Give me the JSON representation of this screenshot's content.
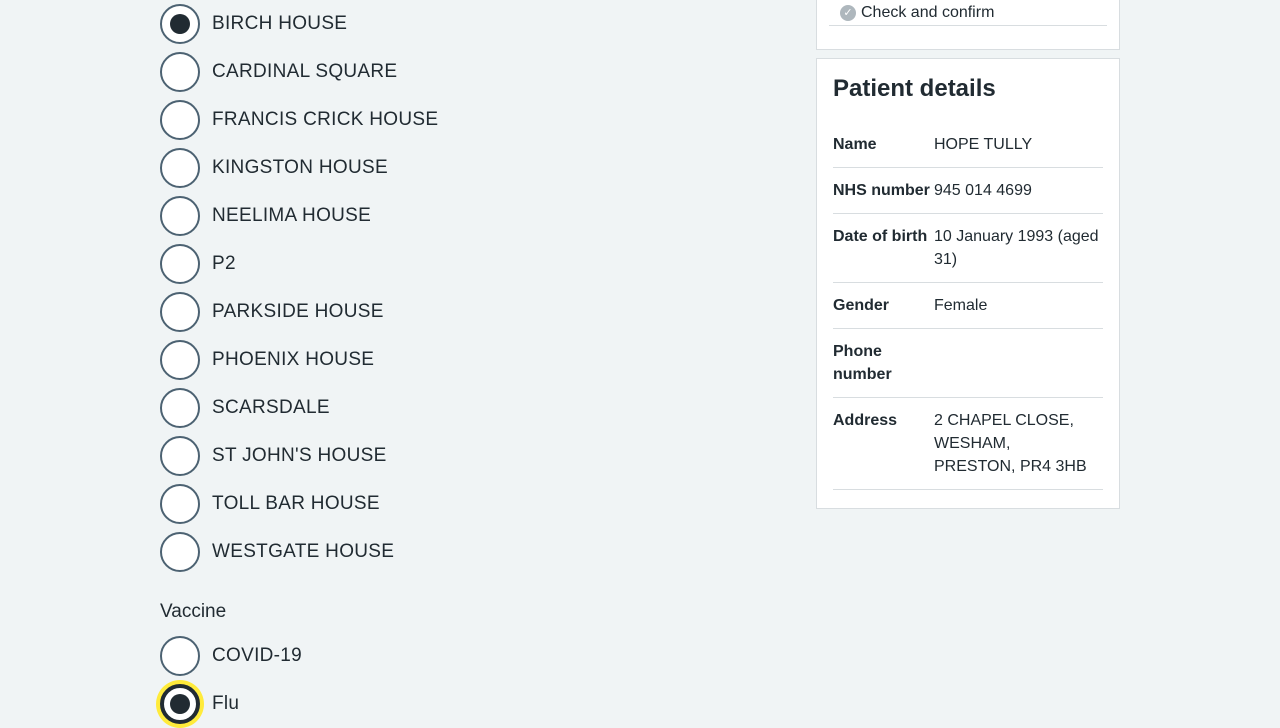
{
  "sites": {
    "options": [
      {
        "label": "BIRCH HOUSE",
        "checked": true
      },
      {
        "label": "CARDINAL SQUARE",
        "checked": false
      },
      {
        "label": "FRANCIS CRICK HOUSE",
        "checked": false
      },
      {
        "label": "KINGSTON HOUSE",
        "checked": false
      },
      {
        "label": "NEELIMA HOUSE",
        "checked": false
      },
      {
        "label": "P2",
        "checked": false
      },
      {
        "label": "PARKSIDE HOUSE",
        "checked": false
      },
      {
        "label": "PHOENIX HOUSE",
        "checked": false
      },
      {
        "label": "SCARSDALE",
        "checked": false
      },
      {
        "label": "ST JOHN'S HOUSE",
        "checked": false
      },
      {
        "label": "TOLL BAR HOUSE",
        "checked": false
      },
      {
        "label": "WESTGATE HOUSE",
        "checked": false
      }
    ]
  },
  "vaccine": {
    "legend": "Vaccine",
    "options": [
      {
        "label": "COVID-19",
        "checked": false,
        "focused": false
      },
      {
        "label": "Flu",
        "checked": true,
        "focused": true
      }
    ]
  },
  "steps": {
    "current": "Check and confirm",
    "icon": "check-icon"
  },
  "patient": {
    "title": "Patient details",
    "name_key": "Name",
    "name_value": "HOPE TULLY",
    "nhs_key": "NHS number",
    "nhs_value": "945 014 4699",
    "dob_key": "Date of birth",
    "dob_value": "10 January 1993 (aged 31)",
    "gender_key": "Gender",
    "gender_value": "Female",
    "phone_key": "Phone number",
    "phone_value": "",
    "address_key": "Address",
    "address_lines": [
      "2 CHAPEL CLOSE,",
      "WESHAM,",
      "PRESTON, PR4 3HB"
    ]
  },
  "colors": {
    "background": "#f0f4f5",
    "text": "#212b32",
    "radio_border": "#4c6272",
    "focus": "#ffeb3b",
    "divider": "#d8dde0"
  }
}
